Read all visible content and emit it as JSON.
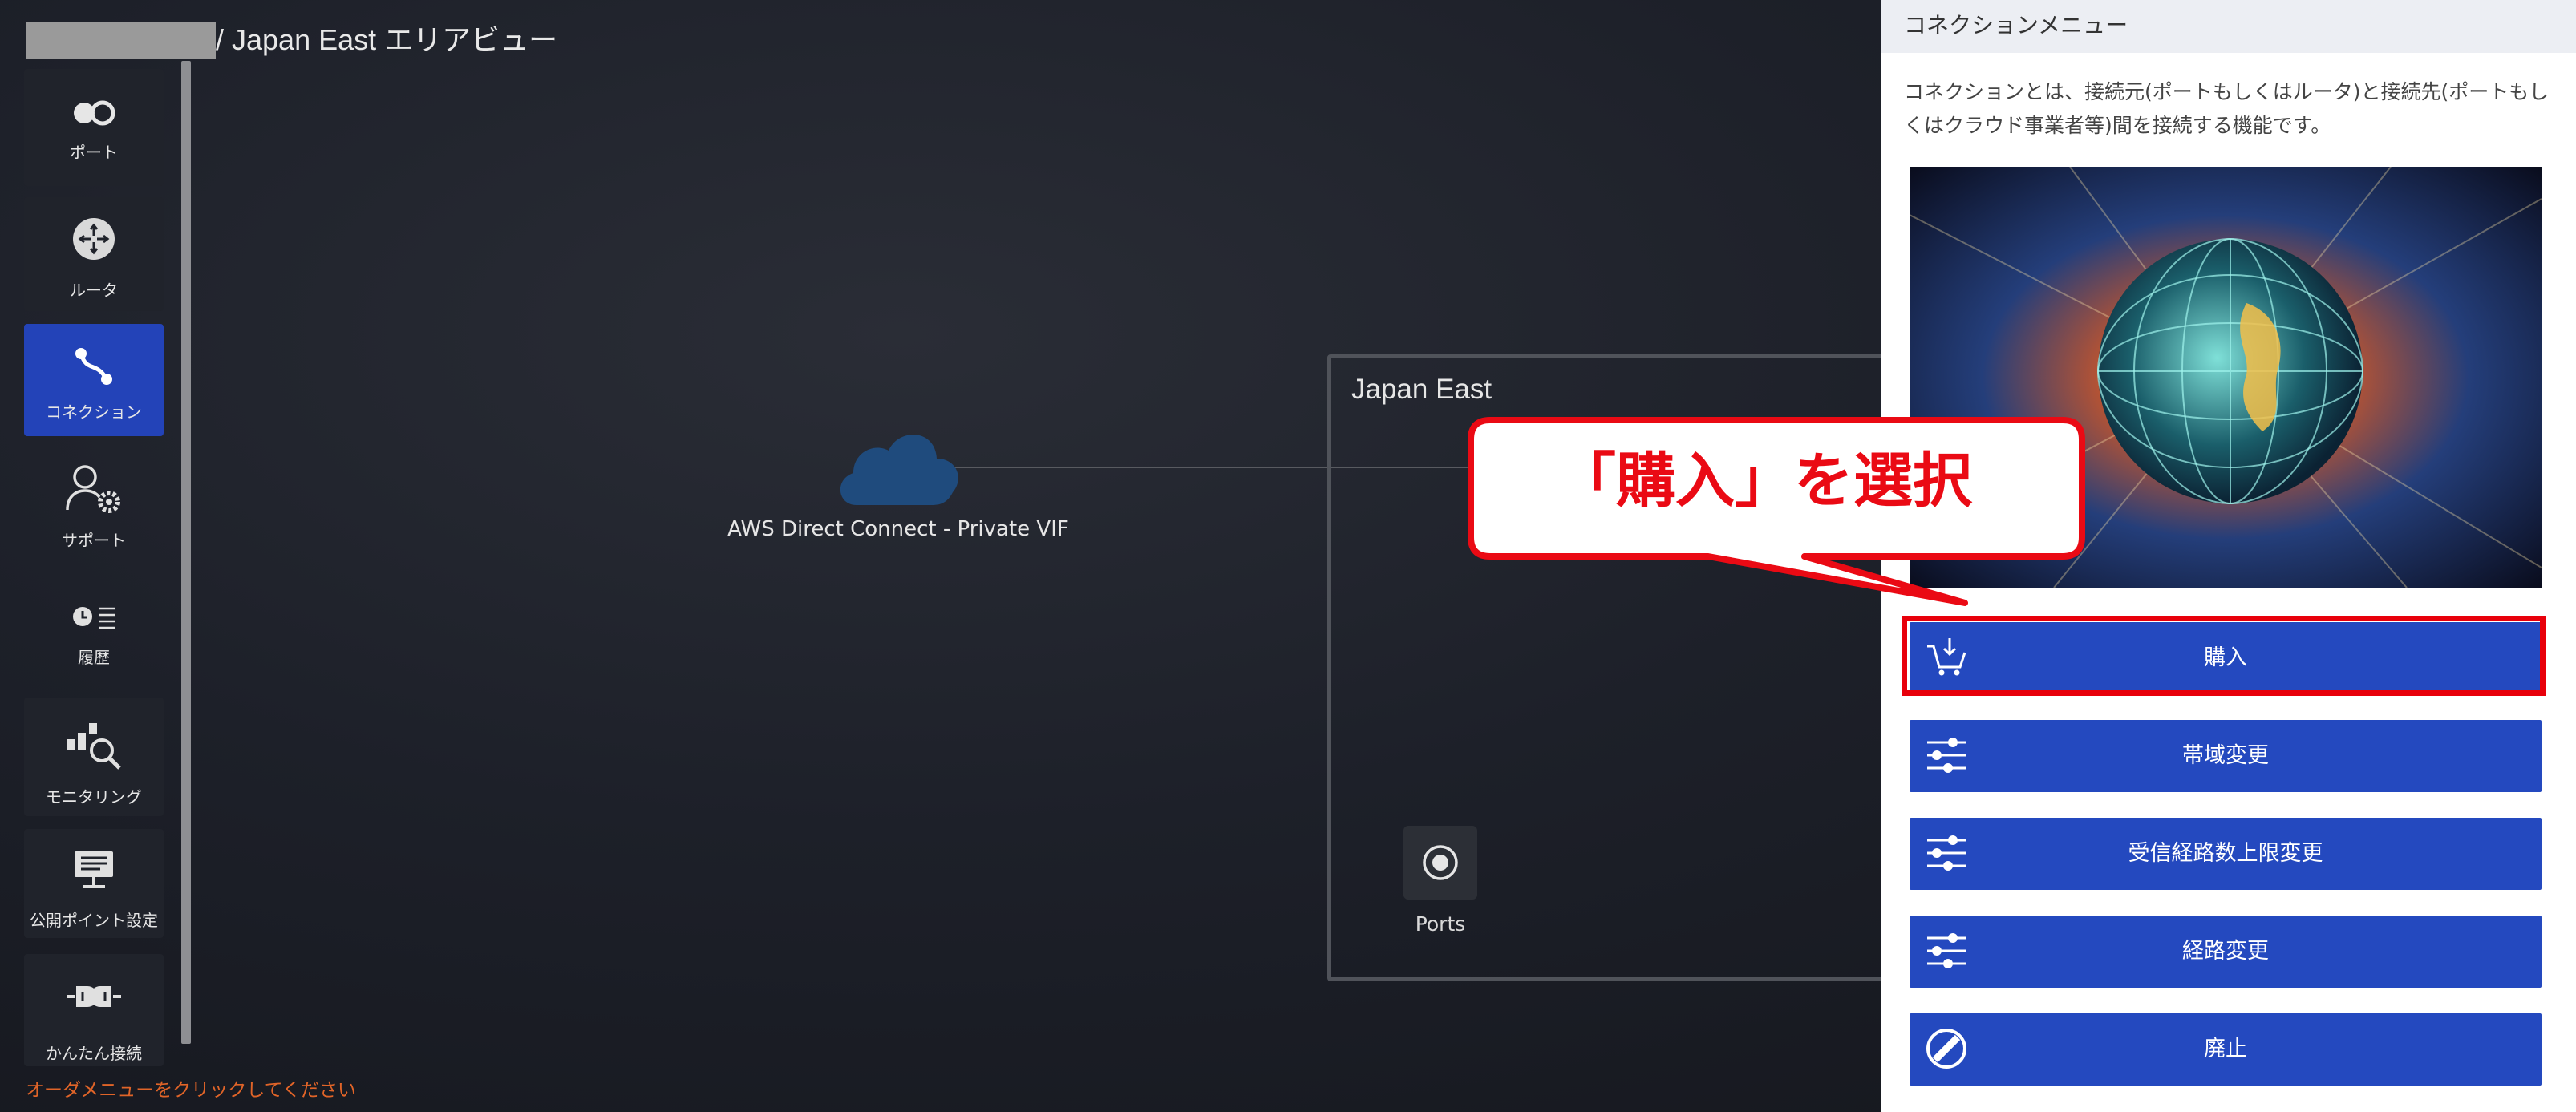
{
  "header": {
    "title": "/ Japan East エリアビュー"
  },
  "sidebar": {
    "items": [
      {
        "label": "ポート",
        "icon": "port-icon"
      },
      {
        "label": "ルータ",
        "icon": "router-icon"
      },
      {
        "label": "コネクション",
        "icon": "connection-icon",
        "active": true
      },
      {
        "label": "サポート",
        "icon": "support-icon"
      },
      {
        "label": "履歴",
        "icon": "history-icon"
      },
      {
        "label": "モニタリング",
        "icon": "monitoring-icon"
      },
      {
        "label": "公開ポイント設定",
        "icon": "public-point-icon"
      },
      {
        "label": "かんたん接続",
        "icon": "easy-connect-icon"
      }
    ],
    "bottom_message": "オーダメニューをクリックしてください"
  },
  "canvas": {
    "cloud_label": "AWS Direct Connect - Private VIF",
    "region_title": "Japan East",
    "ports_label": "Ports"
  },
  "panel": {
    "title": "コネクションメニュー",
    "description": "コネクションとは、接続元(ポートもしくはルータ)と接続先(ポートもしくはクラウド事業者等)間を接続する機能です。",
    "buttons": [
      {
        "label": "購入",
        "icon": "cart-icon"
      },
      {
        "label": "帯域変更",
        "icon": "sliders-icon"
      },
      {
        "label": "受信経路数上限変更",
        "icon": "sliders-icon"
      },
      {
        "label": "経路変更",
        "icon": "sliders-icon"
      },
      {
        "label": "廃止",
        "icon": "ban-icon"
      }
    ]
  },
  "annotation": {
    "callout": "「購入」を選択"
  },
  "colors": {
    "accent": "#2449bf",
    "highlight": "#e8000b",
    "background": "#1b1e25"
  }
}
